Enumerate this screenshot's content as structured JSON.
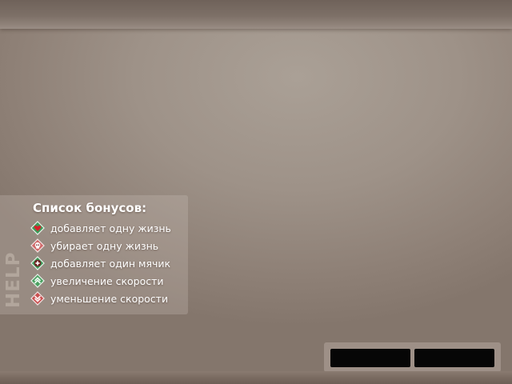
{
  "help_panel": {
    "side_label": "HELP",
    "title": "Список бонусов:",
    "bonuses": [
      {
        "icon": "heart-bonus-icon",
        "label": "добавляет одну жизнь"
      },
      {
        "icon": "skull-bonus-icon",
        "label": "убирает одну жизнь"
      },
      {
        "icon": "plus-ball-bonus-icon",
        "label": "добавляет один мячик"
      },
      {
        "icon": "speed-up-bonus-icon",
        "label": "увеличение скорости"
      },
      {
        "icon": "speed-down-bonus-icon",
        "label": "уменьшение скорости"
      }
    ]
  },
  "buttons": {
    "left_label": "",
    "right_label": ""
  },
  "colors": {
    "background": "#9e9288",
    "text": "#ffffff",
    "button": "#060606",
    "heart_red": "#d8202a",
    "up_green": "#4aa060",
    "down_red": "#c85050"
  }
}
